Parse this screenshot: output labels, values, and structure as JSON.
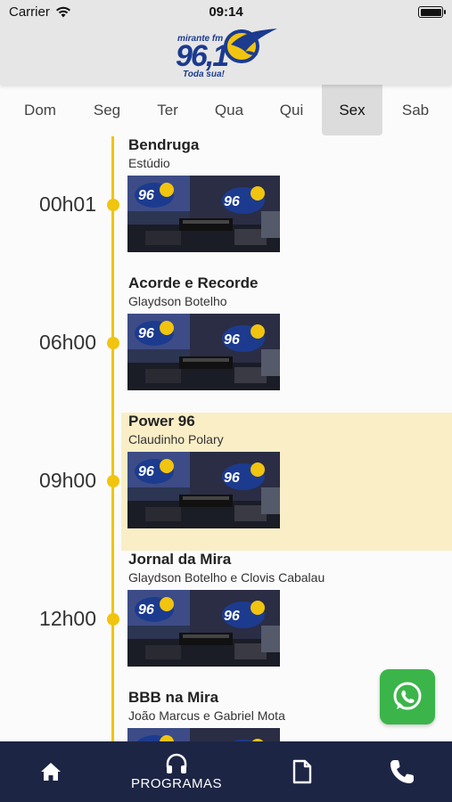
{
  "status_bar": {
    "carrier": "Carrier",
    "time": "09:14"
  },
  "logo": {
    "brand": "mirante fm",
    "frequency": "96,1",
    "slogan": "Toda sua!"
  },
  "days": [
    {
      "label": "Dom",
      "active": false
    },
    {
      "label": "Seg",
      "active": false
    },
    {
      "label": "Ter",
      "active": false
    },
    {
      "label": "Qua",
      "active": false
    },
    {
      "label": "Qui",
      "active": false
    },
    {
      "label": "Sex",
      "active": true
    },
    {
      "label": "Sab",
      "active": false
    }
  ],
  "programs": [
    {
      "time": "00h01",
      "title": "Bendruga",
      "host": "Estúdio",
      "highlight": false
    },
    {
      "time": "06h00",
      "title": "Acorde e Recorde",
      "host": "Glaydson Botelho",
      "highlight": false
    },
    {
      "time": "09h00",
      "title": "Power 96",
      "host": "Claudinho Polary",
      "highlight": true
    },
    {
      "time": "12h00",
      "title": "Jornal da Mira",
      "host": "Glaydson Botelho e Clovis Cabalau",
      "highlight": false
    },
    {
      "time": "",
      "title": "BBB na Mira",
      "host": "João Marcus e Gabriel Mota",
      "highlight": false
    }
  ],
  "bottom_nav": {
    "home_icon": "home-icon",
    "programs_label": "PROGRAMAS",
    "programs_icon": "headphones-icon",
    "document_icon": "document-icon",
    "phone_icon": "phone-icon"
  },
  "colors": {
    "accent": "#f1c40f",
    "nav_bg": "#1d2545",
    "highlight": "#faeec7",
    "whatsapp": "#3bb54a"
  }
}
